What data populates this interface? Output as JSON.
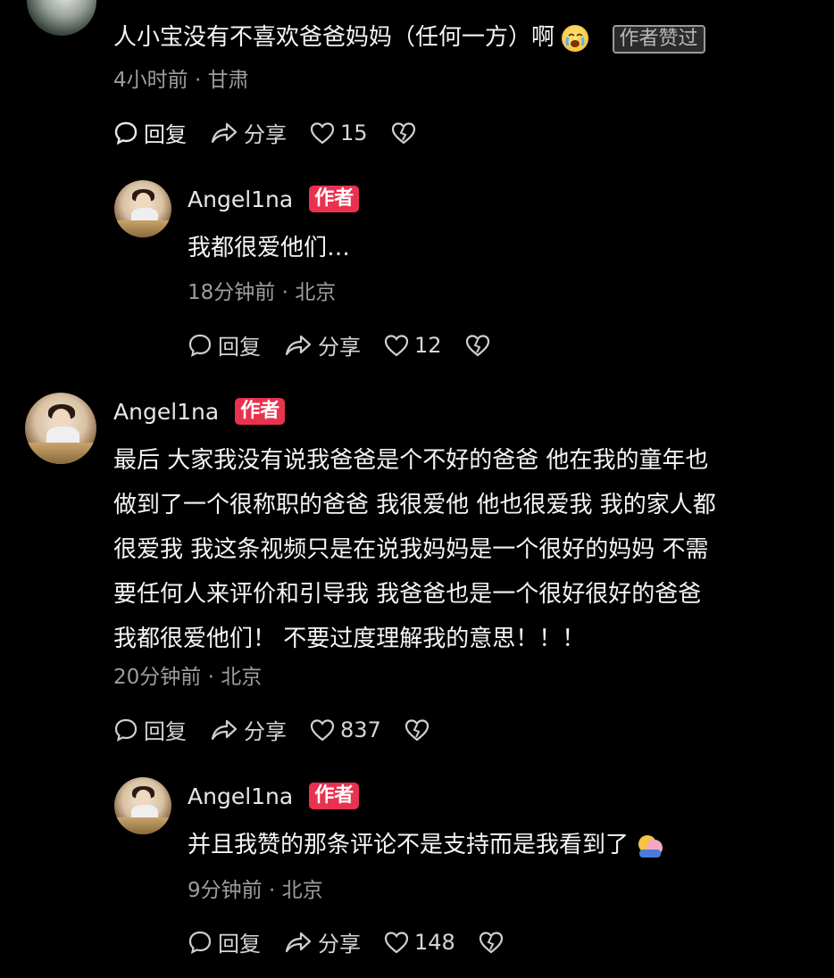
{
  "comment0": {
    "text": "人小宝没有不喜欢爸爸妈妈（任何一方）啊",
    "liked_by_author": "作者赞过",
    "meta": "4小时前 · 甘肃",
    "reply": "回复",
    "share": "分享",
    "likes": "15"
  },
  "reply1": {
    "name": "Angel1na",
    "badge": "作者",
    "text": "我都很爱他们…",
    "meta": "18分钟前 · 北京",
    "reply": "回复",
    "share": "分享",
    "likes": "12"
  },
  "comment2": {
    "name": "Angel1na",
    "badge": "作者",
    "lines": [
      "最后 大家我没有说我爸爸是个不好的爸爸 他在我的童年也",
      "做到了一个很称职的爸爸 我很爱他 他也很爱我 我的家人都",
      "很爱我 我这条视频只是在说我妈妈是一个很好的妈妈 不需",
      "要任何人来评价和引导我 我爸爸也是一个很好很好的爸爸",
      "我都很爱他们！ 不要过度理解我的意思！！！"
    ],
    "meta": "20分钟前 · 北京",
    "reply": "回复",
    "share": "分享",
    "likes": "837"
  },
  "reply3": {
    "name": "Angel1na",
    "badge": "作者",
    "text": "并且我赞的那条评论不是支持而是我看到了",
    "meta": "9分钟前 · 北京",
    "reply": "回复",
    "share": "分享",
    "likes": "148"
  },
  "icons": [
    "comment-icon",
    "share-icon",
    "heart-icon",
    "dislike-icon",
    "crying-emoji-icon",
    "hug-emoji-icon"
  ]
}
